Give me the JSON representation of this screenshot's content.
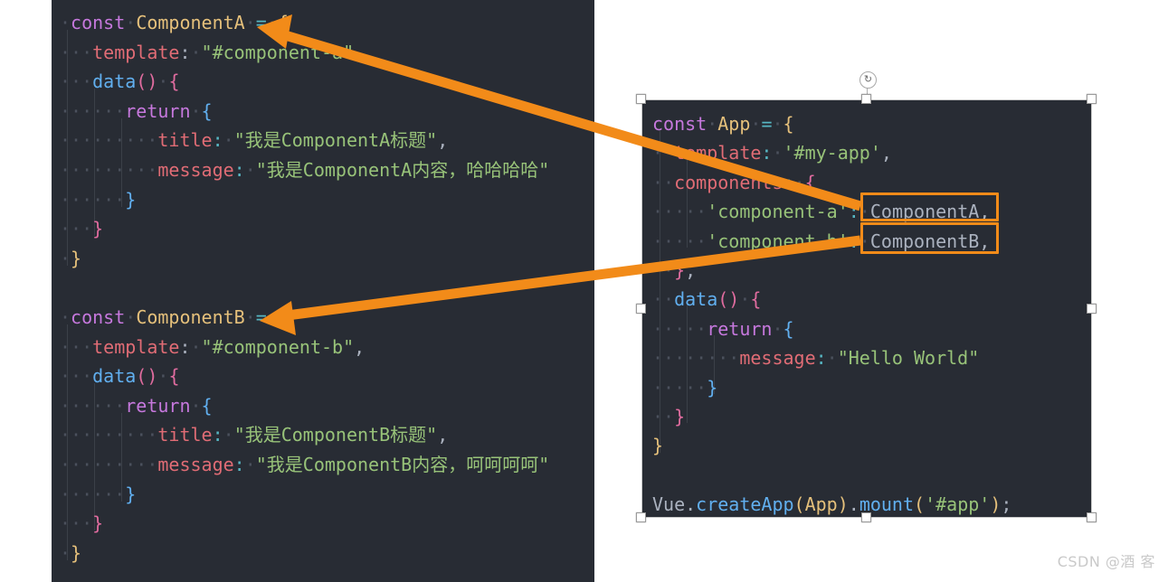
{
  "meta": {
    "watermark": "CSDN @酒 客"
  },
  "left_panel": {
    "name": "component-definitions-code-block",
    "background": "#282c34",
    "lines": [
      {
        "id": "L1",
        "indent": 0,
        "text": "const ComponentA = {"
      },
      {
        "id": "L2",
        "indent": 1,
        "text": "template: \"#component-a\""
      },
      {
        "id": "L3",
        "indent": 1,
        "text": "data() {"
      },
      {
        "id": "L4",
        "indent": 2,
        "text": "return {"
      },
      {
        "id": "L5",
        "indent": 3,
        "text": "title: \"我是ComponentA标题\","
      },
      {
        "id": "L6",
        "indent": 3,
        "text": "message: \"我是ComponentA内容，哈哈哈哈\""
      },
      {
        "id": "L7",
        "indent": 2,
        "text": "}"
      },
      {
        "id": "L8",
        "indent": 1,
        "text": "}"
      },
      {
        "id": "L9",
        "indent": 0,
        "text": "}"
      },
      {
        "id": "L10",
        "indent": 0,
        "text": ""
      },
      {
        "id": "L11",
        "indent": 0,
        "text": "const ComponentB = {"
      },
      {
        "id": "L12",
        "indent": 1,
        "text": "template: \"#component-b\","
      },
      {
        "id": "L13",
        "indent": 1,
        "text": "data() {"
      },
      {
        "id": "L14",
        "indent": 2,
        "text": "return {"
      },
      {
        "id": "L15",
        "indent": 3,
        "text": "title: \"我是ComponentB标题\","
      },
      {
        "id": "L16",
        "indent": 3,
        "text": "message: \"我是ComponentB内容，呵呵呵呵\""
      },
      {
        "id": "L17",
        "indent": 2,
        "text": "}"
      },
      {
        "id": "L18",
        "indent": 1,
        "text": "}"
      },
      {
        "id": "L19",
        "indent": 0,
        "text": "}"
      }
    ]
  },
  "right_panel": {
    "name": "app-root-code-block",
    "background": "#282c34",
    "selected": true,
    "lines": [
      {
        "id": "R1",
        "indent": 0,
        "text": "const App = {"
      },
      {
        "id": "R2",
        "indent": 1,
        "text": "template: '#my-app',"
      },
      {
        "id": "R3",
        "indent": 1,
        "text": "components: {"
      },
      {
        "id": "R4",
        "indent": 2,
        "text": "'component-a': ComponentA,"
      },
      {
        "id": "R5",
        "indent": 2,
        "text": "'component-b': ComponentB,"
      },
      {
        "id": "R6",
        "indent": 1,
        "text": "},"
      },
      {
        "id": "R7",
        "indent": 1,
        "text": "data() {"
      },
      {
        "id": "R8",
        "indent": 2,
        "text": "return {"
      },
      {
        "id": "R9",
        "indent": 3,
        "text": "message: \"Hello World\""
      },
      {
        "id": "R10",
        "indent": 2,
        "text": "}"
      },
      {
        "id": "R11",
        "indent": 1,
        "text": "}"
      },
      {
        "id": "R12",
        "indent": 0,
        "text": "}"
      },
      {
        "id": "R13",
        "indent": 0,
        "text": ""
      },
      {
        "id": "R14",
        "indent": 0,
        "text": "Vue.createApp(App).mount('#app');"
      }
    ]
  },
  "tokens": {
    "left": {
      "L1": {
        "kw": "const",
        "id": "ComponentA",
        "eq": "=",
        "brace": "{"
      },
      "L2": {
        "prop": "template",
        "colon": ":",
        "str": "\"#component-a\""
      },
      "L3": {
        "fn": "data",
        "parens": "()",
        "brace": "{"
      },
      "L4": {
        "kw": "return",
        "brace": "{"
      },
      "L5": {
        "prop": "title",
        "colon": ":",
        "str": "\"我是ComponentA标题\"",
        "comma": ","
      },
      "L6": {
        "prop": "message",
        "colon": ":",
        "str": "\"我是ComponentA内容，哈哈哈哈\""
      },
      "L7": {
        "brace": "}"
      },
      "L8": {
        "brace": "}"
      },
      "L9": {
        "brace": "}"
      },
      "L11": {
        "kw": "const",
        "id": "ComponentB",
        "eq": "=",
        "brace": "{"
      },
      "L12": {
        "prop": "template",
        "colon": ":",
        "str": "\"#component-b\"",
        "comma": ","
      },
      "L13": {
        "fn": "data",
        "parens": "()",
        "brace": "{"
      },
      "L14": {
        "kw": "return",
        "brace": "{"
      },
      "L15": {
        "prop": "title",
        "colon": ":",
        "str": "\"我是ComponentB标题\"",
        "comma": ","
      },
      "L16": {
        "prop": "message",
        "colon": ":",
        "str": "\"我是ComponentB内容，呵呵呵呵\""
      },
      "L17": {
        "brace": "}"
      },
      "L18": {
        "brace": "}"
      },
      "L19": {
        "brace": "}"
      }
    },
    "right": {
      "R1": {
        "kw": "const",
        "id": "App",
        "eq": "=",
        "brace": "{"
      },
      "R2": {
        "prop": "template",
        "colon": ":",
        "str": "'#my-app'",
        "comma": ","
      },
      "R3": {
        "prop": "components",
        "colon": ":",
        "brace": "{"
      },
      "R4": {
        "str": "'component-a'",
        "colon": ":",
        "val": "ComponentA,",
        "highlighted": true
      },
      "R5": {
        "str": "'component-b'",
        "colon": ":",
        "val": "ComponentB,",
        "highlighted": true
      },
      "R6": {
        "brace": "}",
        "comma": ","
      },
      "R7": {
        "fn": "data",
        "parens": "()",
        "brace": "{"
      },
      "R8": {
        "kw": "return",
        "brace": "{"
      },
      "R9": {
        "prop": "message",
        "colon": ":",
        "str": "\"Hello World\""
      },
      "R10": {
        "brace": "}"
      },
      "R11": {
        "brace": "}"
      },
      "R12": {
        "brace": "}"
      },
      "R14": {
        "obj": "Vue",
        "dot1": ".",
        "fn1": "createApp",
        "arg": "App",
        "dot2": ".",
        "fn2": "mount",
        "str": "'#app'",
        "semi": ";"
      }
    }
  },
  "annotations": {
    "accent_color": "#f28b19",
    "highlight_boxes": [
      {
        "name": "component-a-value-highlight",
        "label": "ComponentA,"
      },
      {
        "name": "component-b-value-highlight",
        "label": "ComponentB,"
      }
    ],
    "arrows": [
      {
        "name": "arrow-component-a",
        "from": "ComponentA, in App.components",
        "to": "const ComponentA definition"
      },
      {
        "name": "arrow-component-b",
        "from": "ComponentB, in App.components",
        "to": "const ComponentB definition"
      }
    ]
  },
  "selection": {
    "rotate_handle_glyph": "↻"
  }
}
